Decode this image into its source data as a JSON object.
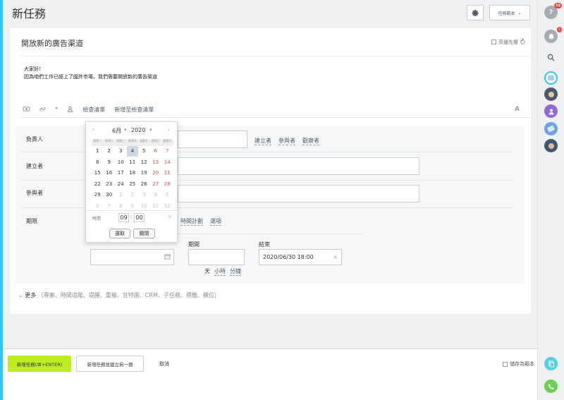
{
  "page": {
    "title": "新任務"
  },
  "header": {
    "template_button": "任務範本"
  },
  "task": {
    "title": "開放新的廣告渠道",
    "priority_label": "高優先權",
    "description_line1": "大家好！",
    "description_line2": "因為咱們工作已經上了國外市場，我們需要開放新的廣告渠道"
  },
  "toolbar": {
    "checklist": "檢查清單",
    "add_to_checklist": "新增至檢查清單",
    "font_icon": "A"
  },
  "form": {
    "responsible_label": "負責人",
    "creator_label": "建立者",
    "participants_label": "參與者",
    "deadline_label": "期限",
    "links": [
      "建立者",
      "參與者",
      "觀察者"
    ],
    "deadline_links": [
      "時間計劃",
      "選項"
    ],
    "duration_label": "期間",
    "end_label": "結束",
    "end_value": "2020/06/30 18:00",
    "units": [
      "天",
      "小時",
      "分鐘"
    ]
  },
  "calendar": {
    "month": "6月",
    "year": "2020",
    "weekdays": [
      "星期一",
      "星期二",
      "星期三",
      "星期四",
      "星期五",
      "星期六",
      "星期日"
    ],
    "weeks": [
      [
        "1",
        "2",
        "3",
        "4",
        "5",
        "6",
        "7"
      ],
      [
        "8",
        "9",
        "10",
        "11",
        "12",
        "13",
        "14"
      ],
      [
        "15",
        "16",
        "17",
        "18",
        "19",
        "20",
        "21"
      ],
      [
        "22",
        "23",
        "24",
        "25",
        "26",
        "27",
        "28"
      ],
      [
        "29",
        "30",
        "1",
        "2",
        "3",
        "4",
        "5"
      ],
      [
        "6",
        "7",
        "8",
        "9",
        "10",
        "11",
        "12"
      ]
    ],
    "time_label": "時間",
    "hour": "09",
    "minute": "00",
    "select_button": "選取",
    "close_button": "關閉"
  },
  "more": {
    "label": "更多",
    "detail": "（專案、時間追蹤、提醒、重複、甘特圖、CRM、子任務、標籤、欄位）"
  },
  "footer": {
    "add_task": "新增任務(⌘+ENTER)",
    "add_and_another": "新增任務並建立另一個",
    "cancel": "取消",
    "save_as_template": "儲存為範本"
  },
  "rightbar": {
    "help_badge": "16",
    "notify_badge": "1"
  }
}
